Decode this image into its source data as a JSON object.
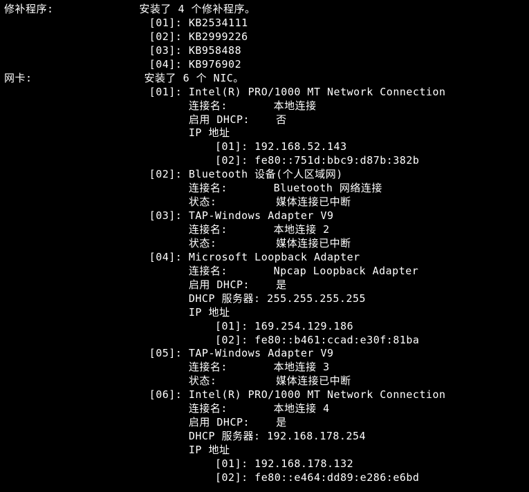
{
  "labels": {
    "hotfix": "修补程序:",
    "nic": "网卡:",
    "conn_name": "连接名:",
    "dhcp_enabled": "启用 DHCP:",
    "dhcp_server": "DHCP 服务器:",
    "status": "状态:",
    "ip_header": "IP 地址"
  },
  "hotfix": {
    "summary": "安装了 4 个修补程序。",
    "items": [
      "[01]: KB2534111",
      "[02]: KB2999226",
      "[03]: KB958488",
      "[04]: KB976902"
    ]
  },
  "nic": {
    "summary": "安装了 6 个 NIC。",
    "adapters": [
      {
        "idx": "[01]:",
        "name": "Intel(R) PRO/1000 MT Network Connection",
        "conn": "本地连接",
        "dhcp": "否",
        "ips": [
          "[01]: 192.168.52.143",
          "[02]: fe80::751d:bbc9:d87b:382b"
        ]
      },
      {
        "idx": "[02]:",
        "name": "Bluetooth 设备(个人区域网)",
        "conn": "Bluetooth 网络连接",
        "status": "媒体连接已中断"
      },
      {
        "idx": "[03]:",
        "name": "TAP-Windows Adapter V9",
        "conn": "本地连接 2",
        "status": "媒体连接已中断"
      },
      {
        "idx": "[04]:",
        "name": "Microsoft Loopback Adapter",
        "conn": "Npcap Loopback Adapter",
        "dhcp": "是",
        "dhcp_server": "255.255.255.255",
        "ips": [
          "[01]: 169.254.129.186",
          "[02]: fe80::b461:ccad:e30f:81ba"
        ]
      },
      {
        "idx": "[05]:",
        "name": "TAP-Windows Adapter V9",
        "conn": "本地连接 3",
        "status": "媒体连接已中断"
      },
      {
        "idx": "[06]:",
        "name": "Intel(R) PRO/1000 MT Network Connection",
        "conn": "本地连接 4",
        "dhcp": "是",
        "dhcp_server": "192.168.178.254",
        "ips": [
          "[01]: 192.168.178.132",
          "[02]: fe80::e464:dd89:e286:e6bd"
        ]
      }
    ]
  }
}
